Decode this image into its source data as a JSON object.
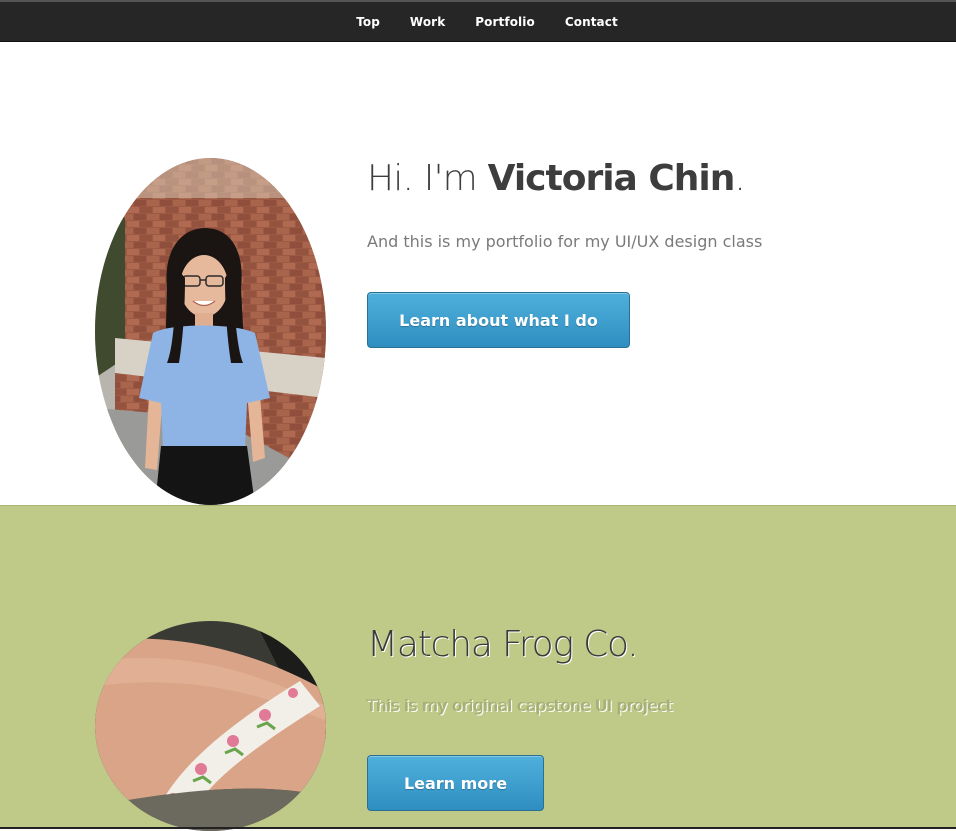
{
  "nav": {
    "items": [
      {
        "label": "Top"
      },
      {
        "label": "Work"
      },
      {
        "label": "Portfolio"
      },
      {
        "label": "Contact"
      }
    ]
  },
  "hero": {
    "title_prefix": "Hi. I'm ",
    "title_name": "Victoria Chin",
    "title_suffix": ".",
    "subtitle": "And this is my portfolio for my UI/UX design class",
    "button_label": "Learn about what I do"
  },
  "work": {
    "title": "Matcha Frog Co.",
    "subtitle": "This is my original capstone UI project",
    "button_label": "Learn more"
  },
  "colors": {
    "nav_bg": "#262626",
    "button_blue": "#3a9fcf",
    "work_bg": "#bfca88",
    "text_dark": "#3d3d3d"
  }
}
